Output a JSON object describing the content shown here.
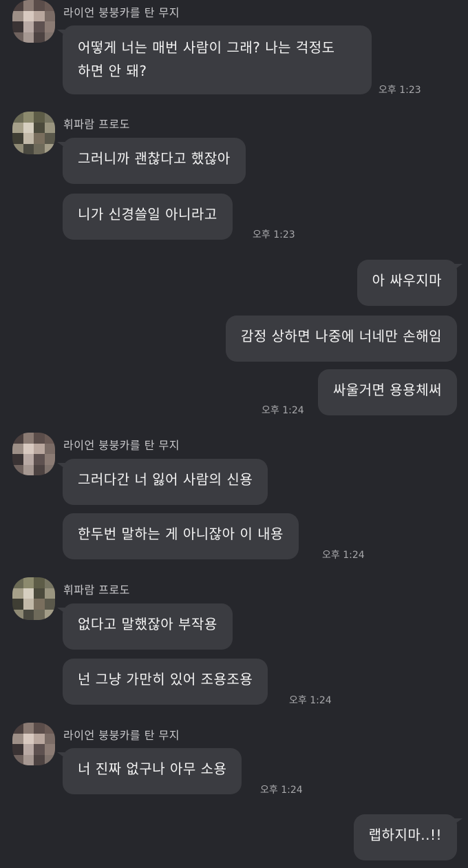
{
  "senders": {
    "ryan": "라이언 붕붕카를 탄 무지",
    "frodo": "휘파람 프로도"
  },
  "messages": [
    {
      "id": "m1",
      "text_line1": "어떻게 너는 매번 사람이 그래? 나는 걱정도",
      "text_line2": "하면 안 돼?"
    },
    {
      "id": "m2",
      "text": "그러니까 괜찮다고 했잖아"
    },
    {
      "id": "m3",
      "text": "니가 신경쓸일 아니라고"
    },
    {
      "id": "m4",
      "text": "아 싸우지마"
    },
    {
      "id": "m5",
      "text": "감정 상하면 나중에 너네만 손해임"
    },
    {
      "id": "m6",
      "text": "싸울거면 용용체써"
    },
    {
      "id": "m7",
      "text": "그러다간 너 잃어 사람의 신용"
    },
    {
      "id": "m8",
      "text": "한두번 말하는 게 아니잖아 이 내용"
    },
    {
      "id": "m9",
      "text": "없다고 말했잖아 부작용"
    },
    {
      "id": "m10",
      "text": "넌 그냥 가만히 있어 조용조용"
    },
    {
      "id": "m11",
      "text": "너 진짜 없구나 아무 소용"
    },
    {
      "id": "m12",
      "text": "랩하지마..!!"
    }
  ],
  "times": {
    "t1": "오후 1:23",
    "t2": "오후 1:23",
    "t3": "오후 1:24",
    "t4": "오후 1:24",
    "t5": "오후 1:24",
    "t6": "오후 1:24"
  },
  "colors": {
    "background": "#26272c",
    "bubble": "#3b3c41",
    "text": "#f4f4f4",
    "timestamp": "#a8a8ab"
  }
}
